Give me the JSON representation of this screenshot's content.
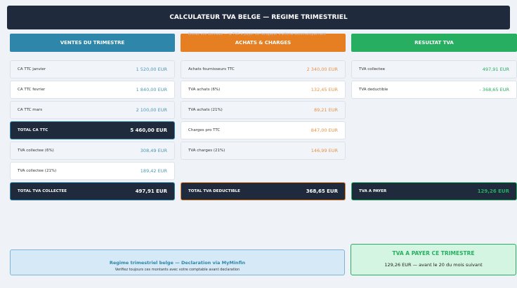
{
  "title": "CALCULATEUR TVA BELGE — REGIME TRIMESTRIEL",
  "subtitle": "Entrez vos donnees — la TVA a payer ou recuperer s'affiche automatiquement",
  "colors": {
    "blue": "#2e86ab",
    "orange": "#e67e22",
    "green": "#27ae60",
    "dark": "#1f2a3c"
  },
  "ventes": {
    "header": "VENTES DU TRIMESTRE",
    "rows": [
      {
        "label": "CA TTC janvier",
        "value": "1 520,00 EUR"
      },
      {
        "label": "CA TTC fevrier",
        "value": "1 840,00 EUR"
      },
      {
        "label": "CA TTC mars",
        "value": "2 100,00 EUR"
      },
      {
        "label": "TOTAL CA TTC",
        "value": "5 460,00 EUR"
      },
      {
        "label": "TVA collectee (6%)",
        "value": "308,49 EUR"
      },
      {
        "label": "TVA collectee (21%)",
        "value": "189,42 EUR"
      },
      {
        "label": "TOTAL TVA COLLECTEE",
        "value": "497,91 EUR"
      }
    ]
  },
  "achats": {
    "header": "ACHATS & CHARGES",
    "rows": [
      {
        "label": "Achats fournisseurs TTC",
        "value": "2 340,00 EUR"
      },
      {
        "label": "TVA achats (6%)",
        "value": "132,45 EUR"
      },
      {
        "label": "TVA achats (21%)",
        "value": "89,21 EUR"
      },
      {
        "label": "Charges pro TTC",
        "value": "847,00 EUR"
      },
      {
        "label": "TVA charges (21%)",
        "value": "146,99 EUR"
      },
      {
        "label": "TOTAL TVA DEDUCTIBLE",
        "value": "368,65 EUR"
      }
    ]
  },
  "resultat": {
    "header": "RESULTAT TVA",
    "rows": [
      {
        "label": "TVA collectee",
        "value": "497,91 EUR"
      },
      {
        "label": "TVA deductible",
        "value": "- 368,65 EUR"
      },
      {
        "label": "TVA A PAYER",
        "value": "129,26 EUR"
      }
    ]
  },
  "note": {
    "title": "Regime trimestriel belge — Declaration via MyMinfin",
    "text": "Verifiez toujours ces montants avec votre comptable avant declaration"
  },
  "pay": {
    "title": "TVA A PAYER CE TRIMESTRE",
    "text": "129,26 EUR — avant le 20 du mois suivant"
  }
}
